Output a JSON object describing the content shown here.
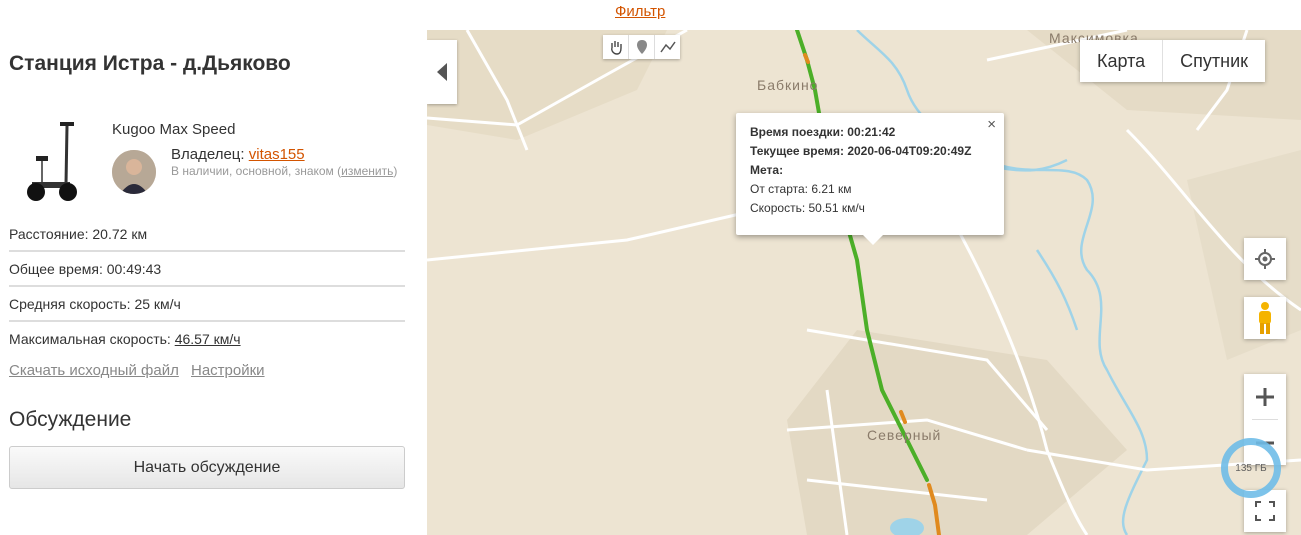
{
  "filter_link": "Фильтр",
  "sidebar": {
    "title": "Станция Истра - д.Дьяково",
    "device": "Kugoo Max Speed",
    "owner_label": "Владелец:",
    "owner_name": "vitas155",
    "owner_status": "В наличии, основной, знаком",
    "owner_change": "изменить",
    "stats": {
      "distance": "Расстояние: 20.72 км",
      "total_time": "Общее время: 00:49:43",
      "avg_speed": "Средняя скорость: 25 км/ч",
      "max_speed_label": "Максимальная скорость:",
      "max_speed_value": "46.57 км/ч"
    },
    "links": {
      "download": "Скачать исходный файл",
      "settings": "Настройки"
    },
    "discussion_title": "Обсуждение",
    "discussion_button": "Начать обсуждение"
  },
  "map": {
    "types": [
      "Карта",
      "Спутник"
    ],
    "places": [
      "Максимовка",
      "Бабкино",
      "Северный"
    ],
    "popup": {
      "ride_time": "Время поездки: 00:21:42",
      "current_time": "Текущее время: 2020-06-04T09:20:49Z",
      "mark": "Мета:",
      "from_start": "От старта: 6.21 км",
      "speed": "Скорость: 50.51 км/ч",
      "close": "×"
    },
    "storage_badge": "135 ГБ",
    "colors": {
      "track_green": "#4caf28",
      "track_orange": "#e08a1e",
      "water": "#9fd3e8",
      "road": "#ffffff"
    }
  }
}
